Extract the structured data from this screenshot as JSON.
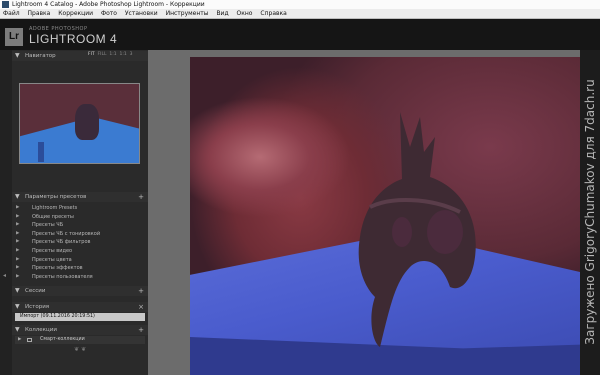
{
  "window": {
    "title": "Lightroom 4 Catalog - Adobe Photoshop Lightroom - Коррекции"
  },
  "menubar": {
    "items": [
      "Файл",
      "Правка",
      "Коррекции",
      "Фото",
      "Установки",
      "Инструменты",
      "Вид",
      "Окно",
      "Справка"
    ]
  },
  "brand": {
    "logo": "Lr",
    "top": "ADOBE PHOTOSHOP",
    "name": "LIGHTROOM 4"
  },
  "navigator": {
    "title": "Навигатор",
    "zoom": [
      "FIT",
      "FILL",
      "1:1",
      "1:1",
      "3"
    ]
  },
  "presets": {
    "title": "Параметры пресетов",
    "items": [
      "Lightroom Presets",
      "Общие пресеты",
      "Пресеты ЧБ",
      "Пресеты ЧБ с тонировкой",
      "Пресеты ЧБ фильтров",
      "Пресеты видео",
      "Пресеты цвета",
      "Пресеты эффектов",
      "Пресеты пользователя"
    ]
  },
  "sessions": {
    "title": "Сессии"
  },
  "history": {
    "title": "История",
    "item": "Импорт (09.11.2016 20:19:51)"
  },
  "collections": {
    "title": "Коллекции",
    "item": "Смарт-коллекции"
  },
  "watermark": "Загружено GrigoryChumakov для 7dach.ru",
  "colors": {
    "panel": "#2a2a2a",
    "header": "#151515",
    "center": "#6c6c6c"
  }
}
